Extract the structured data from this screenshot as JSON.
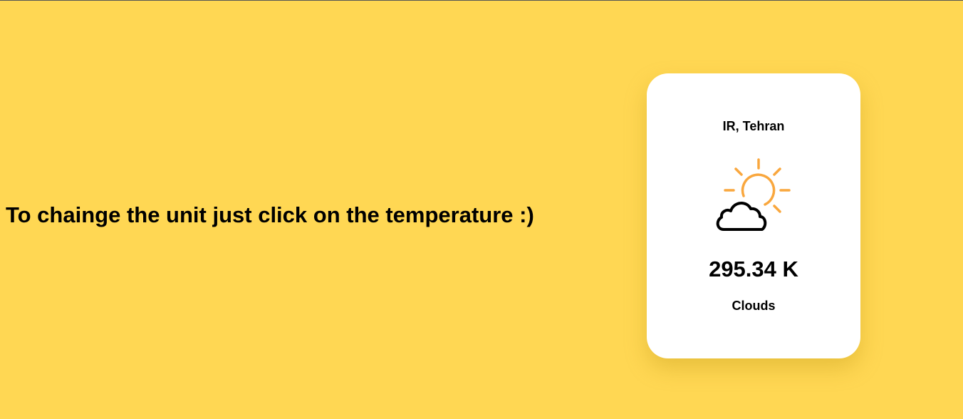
{
  "hint": {
    "text": "To chainge the unit just click on the temperature :)"
  },
  "card": {
    "location": "IR, Tehran",
    "icon": "sun-behind-cloud-icon",
    "temperature": "295.34 K",
    "condition": "Clouds",
    "colors": {
      "background": "#FFD753",
      "card": "#FFFFFF",
      "sun": "#F9A73E",
      "cloud": "#000000"
    }
  }
}
